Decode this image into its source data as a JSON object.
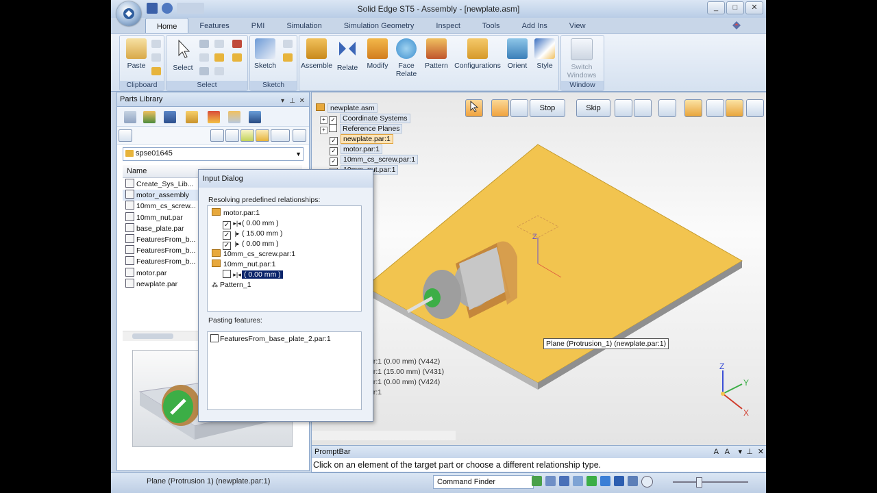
{
  "window": {
    "title": "Solid Edge ST5 - Assembly - [newplate.asm]",
    "controls": [
      "_",
      "□",
      "✕"
    ]
  },
  "ribbon": {
    "tabs": [
      "Home",
      "Features",
      "PMI",
      "Simulation",
      "Simulation Geometry",
      "Inspect",
      "Tools",
      "Add Ins",
      "View"
    ],
    "active_tab": "Home",
    "groups": {
      "clipboard": {
        "label": "Clipboard",
        "paste": "Paste"
      },
      "select": {
        "label": "Select",
        "select": "Select"
      },
      "sketch": {
        "label": "Sketch",
        "sketch": "Sketch"
      },
      "assemble": {
        "assemble": "Assemble",
        "relate": "Relate",
        "modify": "Modify",
        "face_relate": "Face Relate",
        "pattern": "Pattern",
        "configurations": "Configurations",
        "orient": "Orient",
        "style": "Style"
      },
      "window": {
        "label": "Window",
        "switch_windows": "Switch Windows"
      }
    }
  },
  "parts_library": {
    "title": "Parts Library",
    "folder": "spse01645",
    "column_name": "Name",
    "files": [
      "Create_Sys_Lib...",
      "motor_assembly",
      "10mm_cs_screw...",
      "10mm_nut.par",
      "base_plate.par",
      "FeaturesFrom_b...",
      "FeaturesFrom_b...",
      "FeaturesFrom_b...",
      "motor.par",
      "newplate.par"
    ]
  },
  "assembly_tree": {
    "root": "newplate.asm",
    "items": [
      {
        "label": "Coordinate Systems",
        "checked": true
      },
      {
        "label": "Reference Planes",
        "checked": false
      },
      {
        "label": "newplate.par:1",
        "checked": true
      },
      {
        "label": "motor.par:1",
        "checked": true
      },
      {
        "label": "10mm_cs_screw.par:1",
        "checked": true
      },
      {
        "label": "10mm_nut.par:1",
        "checked": true
      }
    ],
    "relationship_rows": [
      {
        "part": "ar:1",
        "value": "(0.00 mm)",
        "code": "(V442)"
      },
      {
        "part": "ar:1",
        "value": "(15.00 mm)",
        "code": "(V431)"
      },
      {
        "part": "ar:1",
        "value": "(0.00 mm)",
        "code": "(V424)"
      },
      {
        "part": "ar:1",
        "value": "",
        "code": ""
      }
    ]
  },
  "command_bar": {
    "stop": "Stop",
    "skip": "Skip"
  },
  "viewport": {
    "tooltip": "Plane (Protrusion_1) (newplate.par:1)",
    "triad": {
      "x": "X",
      "y": "Y",
      "z": "Z"
    },
    "colors": {
      "plate": "#f2c44f",
      "plate_edge": "#b98f22",
      "motor_bracket": "#d8a85a",
      "shaft": "#3fb34f"
    }
  },
  "input_dialog": {
    "title": "Input Dialog",
    "resolving_label": "Resolving predefined relationships:",
    "tree": [
      {
        "type": "folder",
        "label": "motor.par:1"
      },
      {
        "type": "rel",
        "checked": true,
        "value": "( 0.00 mm )"
      },
      {
        "type": "rel",
        "checked": true,
        "value": "( 15.00 mm )"
      },
      {
        "type": "rel",
        "checked": true,
        "value": "( 0.00 mm )"
      },
      {
        "type": "folder",
        "label": "10mm_cs_screw.par:1"
      },
      {
        "type": "folder",
        "label": "10mm_nut.par:1"
      },
      {
        "type": "rel",
        "checked": false,
        "value": "( 0.00 mm )",
        "selected": true
      },
      {
        "type": "pattern",
        "label": "Pattern_1"
      }
    ],
    "pasting_label": "Pasting features:",
    "pasting_items": [
      "FeaturesFrom_base_plate_2.par:1"
    ]
  },
  "promptbar": {
    "title": "PromptBar",
    "text": "Click on an element of the target part or choose a different relationship type."
  },
  "statusbar": {
    "text": "Plane (Protrusion 1) (newplate.par:1)",
    "command_finder": "Command Finder"
  }
}
